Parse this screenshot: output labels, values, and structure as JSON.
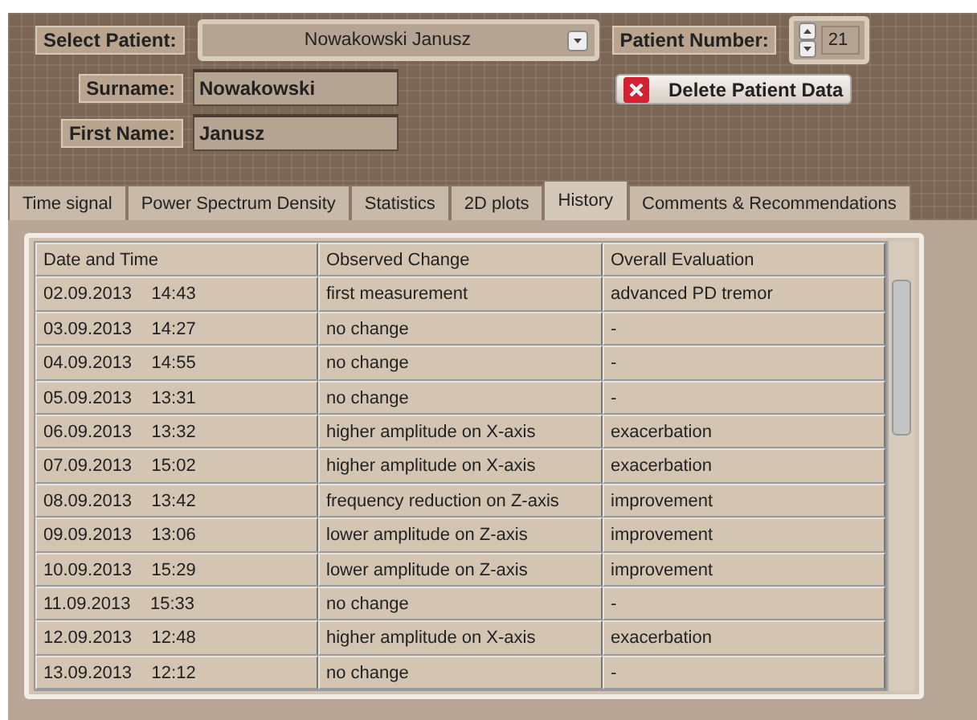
{
  "patient": {
    "select_label": "Select Patient:",
    "selected_patient": "Nowakowski  Janusz",
    "number_label": "Patient Number:",
    "number": "21",
    "surname_label": "Surname:",
    "surname": "Nowakowski",
    "first_name_label": "First Name:",
    "first_name": "Janusz",
    "delete_button": "Delete Patient Data"
  },
  "tabs": [
    {
      "label": "Time signal",
      "selected": false
    },
    {
      "label": "Power Spectrum Density",
      "selected": false
    },
    {
      "label": "Statistics",
      "selected": false
    },
    {
      "label": "2D plots",
      "selected": false
    },
    {
      "label": "History",
      "selected": true
    },
    {
      "label": "Comments & Recommendations",
      "selected": false
    }
  ],
  "table": {
    "columns": [
      "Date and Time",
      "Observed Change",
      "Overall Evaluation"
    ],
    "rows": [
      [
        "02.09.2013    14:43",
        "first measurement",
        "advanced PD tremor"
      ],
      [
        "03.09.2013    14:27",
        "no change",
        "-"
      ],
      [
        "04.09.2013    14:55",
        "no change",
        "-"
      ],
      [
        "05.09.2013    13:31",
        "no change",
        "-"
      ],
      [
        "06.09.2013    13:32",
        "higher amplitude on X-axis",
        "exacerbation"
      ],
      [
        "07.09.2013    15:02",
        "higher amplitude on X-axis",
        "exacerbation"
      ],
      [
        "08.09.2013    13:42",
        "frequency reduction on Z-axis",
        "improvement"
      ],
      [
        "09.09.2013    13:06",
        "lower amplitude on Z-axis",
        "improvement"
      ],
      [
        "10.09.2013    15:29",
        "lower amplitude on Z-axis",
        "improvement"
      ],
      [
        "11.09.2013    15:33",
        "no change",
        "-"
      ],
      [
        "12.09.2013    12:48",
        "higher amplitude on X-axis",
        "exacerbation"
      ],
      [
        "13.09.2013    12:12",
        "no change",
        "-"
      ]
    ]
  }
}
